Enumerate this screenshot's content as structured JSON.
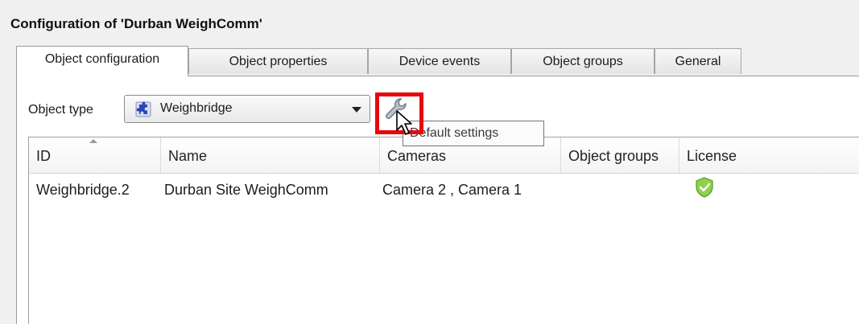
{
  "window": {
    "title": "Configuration of 'Durban WeighComm'"
  },
  "tabs": [
    {
      "label": "Object configuration",
      "active": true
    },
    {
      "label": "Object properties",
      "active": false
    },
    {
      "label": "Device events",
      "active": false
    },
    {
      "label": "Object groups",
      "active": false
    },
    {
      "label": "General",
      "active": false
    }
  ],
  "object_type": {
    "label": "Object type",
    "selected": "Weighbridge",
    "icon": "puzzle-icon"
  },
  "default_settings": {
    "icon": "wrench-icon",
    "tooltip": "Default settings",
    "highlight_color": "#e8070d"
  },
  "table": {
    "columns": [
      "ID",
      "Name",
      "Cameras",
      "Object groups",
      "License"
    ],
    "rows": [
      {
        "id": "Weighbridge.2",
        "name": "Durban Site WeighComm",
        "cameras": "Camera 2 , Camera 1",
        "object_groups": "",
        "license_icon": "license-shield-check-icon"
      }
    ]
  }
}
